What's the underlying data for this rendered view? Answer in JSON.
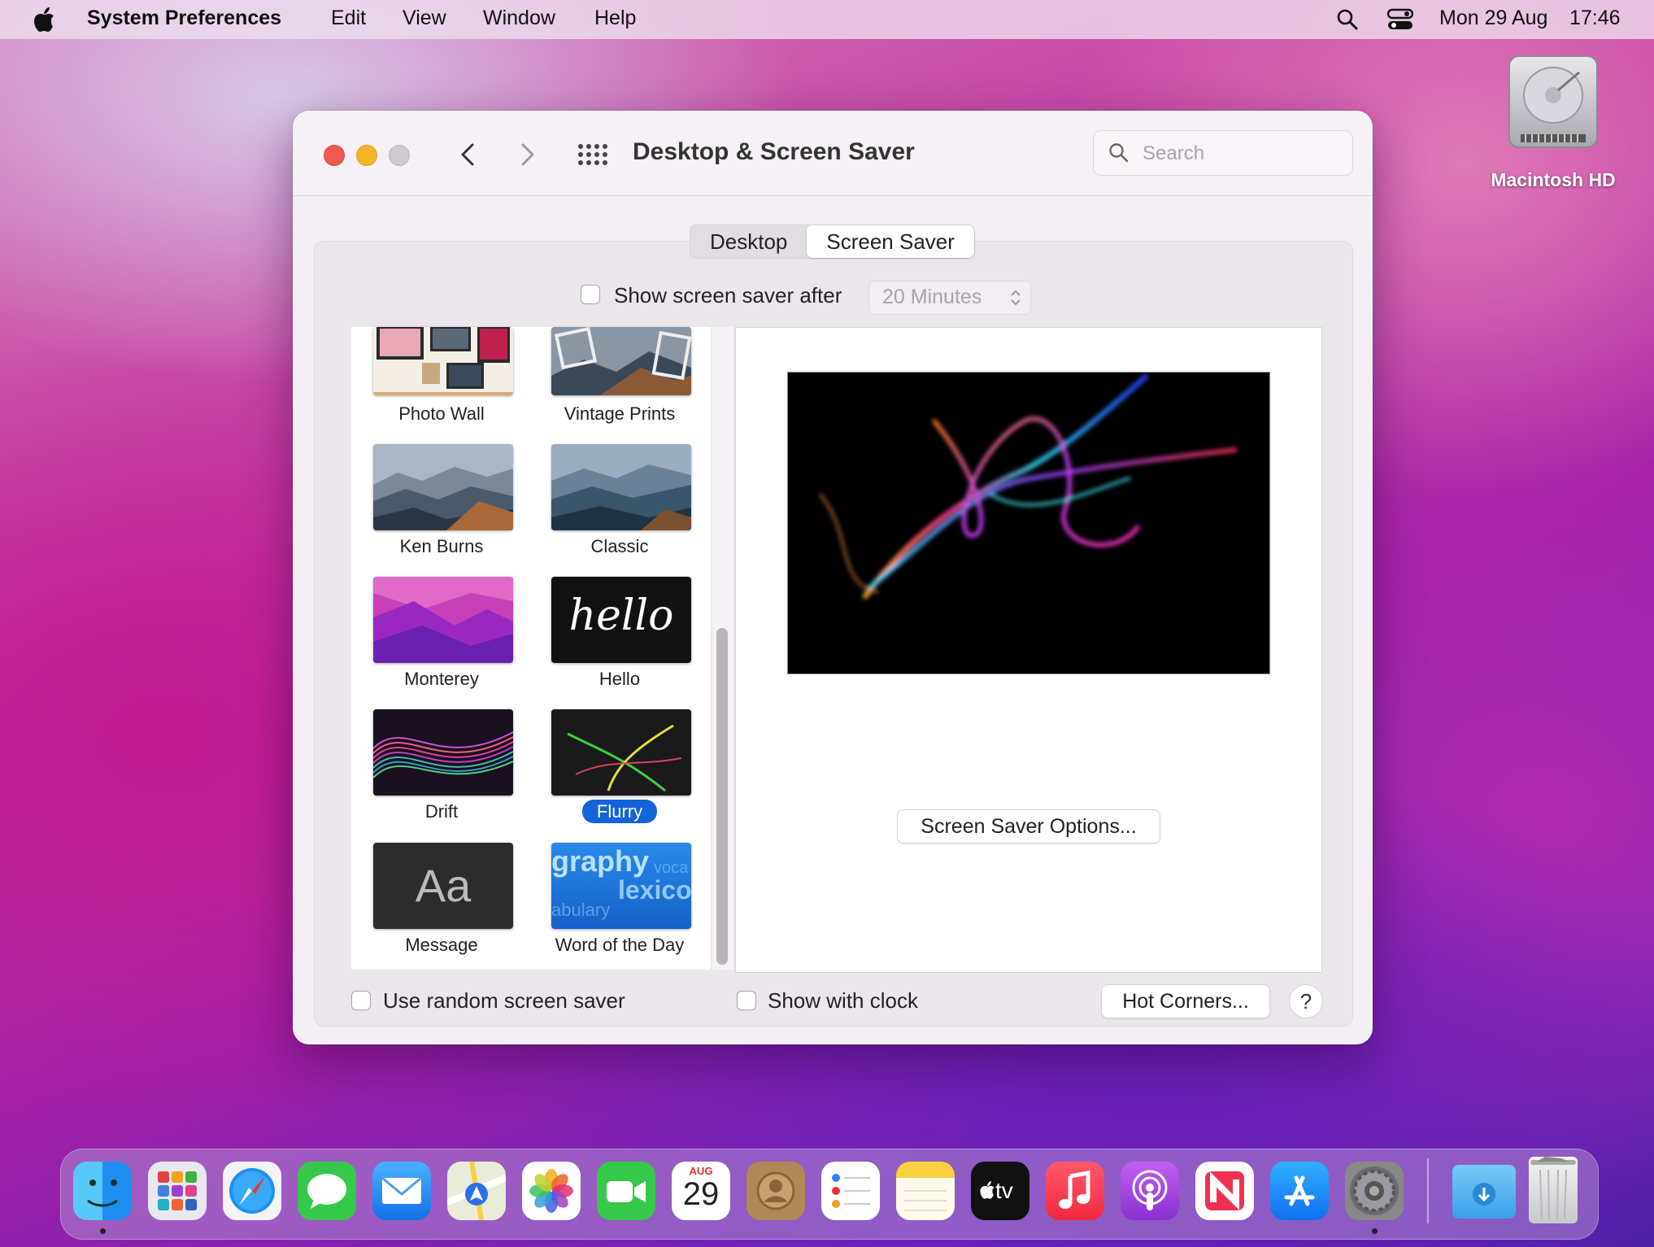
{
  "menubar": {
    "app_name": "System Preferences",
    "items": [
      "Edit",
      "View",
      "Window",
      "Help"
    ],
    "date": "Mon 29 Aug",
    "time": "17:46"
  },
  "desktop": {
    "hd_label": "Macintosh HD"
  },
  "window": {
    "title": "Desktop & Screen Saver",
    "search_placeholder": "Search",
    "tabs": [
      {
        "label": "Desktop",
        "active": false
      },
      {
        "label": "Screen Saver",
        "active": true
      }
    ],
    "show_after_label": "Show screen saver after",
    "show_after_value": "20 Minutes",
    "savers": [
      {
        "label": "Photo Wall",
        "selected": false
      },
      {
        "label": "Vintage Prints",
        "selected": false
      },
      {
        "label": "Ken Burns",
        "selected": false
      },
      {
        "label": "Classic",
        "selected": false
      },
      {
        "label": "Monterey",
        "selected": false
      },
      {
        "label": "Hello",
        "selected": false
      },
      {
        "label": "Drift",
        "selected": false
      },
      {
        "label": "Flurry",
        "selected": true
      },
      {
        "label": "Message",
        "selected": false
      },
      {
        "label": "Word of the Day",
        "selected": false
      }
    ],
    "hello_text": "hello",
    "message_text": "Aa",
    "word_text": [
      "graphy",
      "voca",
      "lexicog",
      "abulary"
    ],
    "options_button": "Screen Saver Options...",
    "random_label": "Use random screen saver",
    "clock_label": "Show with clock",
    "hot_corners_button": "Hot Corners...",
    "help_label": "?"
  },
  "dock": {
    "calendar_month": "AUG",
    "calendar_day": "29",
    "tv_label": "tv",
    "apps": [
      "Finder",
      "Launchpad",
      "Safari",
      "Messages",
      "Mail",
      "Maps",
      "Photos",
      "FaceTime",
      "Calendar",
      "Contacts",
      "Reminders",
      "Notes",
      "TV",
      "Music",
      "Podcasts",
      "News",
      "App Store",
      "System Preferences",
      "Downloads",
      "Trash"
    ]
  }
}
